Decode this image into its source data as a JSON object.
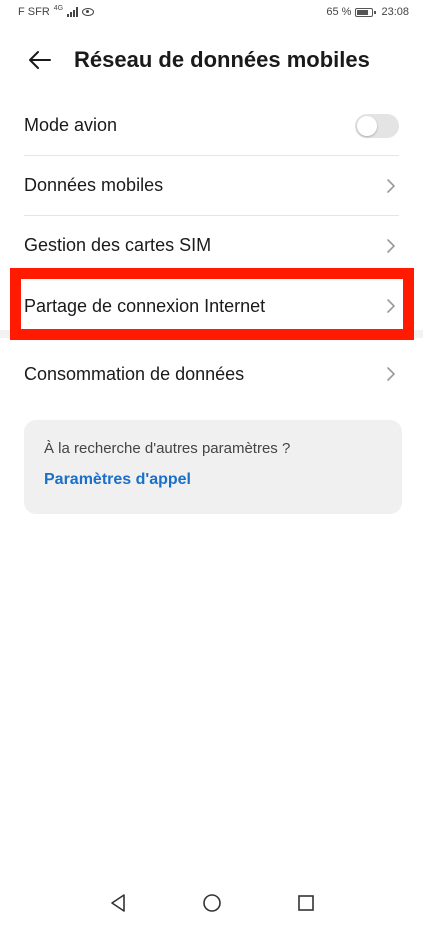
{
  "status_bar": {
    "carrier": "F SFR",
    "network": "4G",
    "battery_percent": "65 %",
    "time": "23:08"
  },
  "header": {
    "title": "Réseau de données mobiles"
  },
  "list": {
    "items": [
      {
        "label": "Mode avion",
        "control": "toggle",
        "enabled": false
      },
      {
        "label": "Données mobiles",
        "control": "chevron"
      },
      {
        "label": "Gestion des cartes SIM",
        "control": "chevron"
      },
      {
        "label": "Partage de connexion Internet",
        "control": "chevron",
        "highlighted": true
      },
      {
        "label": "Consommation de données",
        "control": "chevron"
      }
    ]
  },
  "suggest": {
    "text": "À la recherche d'autres paramètres ?",
    "link": "Paramètres d'appel"
  },
  "colors": {
    "highlight": "#ff1a00",
    "link": "#1b6fc8",
    "toggle_off": "#e4e4e4",
    "card_bg": "#f0f0f0"
  },
  "icons": {
    "back": "arrow-left-icon",
    "chevron": "chevron-right-icon",
    "nav_back": "triangle-back-icon",
    "nav_home": "circle-home-icon",
    "nav_recent": "square-recent-icon"
  }
}
